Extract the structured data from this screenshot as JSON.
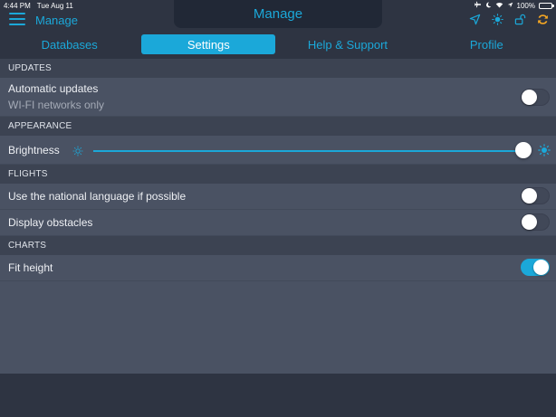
{
  "status_bar": {
    "time": "4:44 PM",
    "date": "Tue Aug 11",
    "battery": "100%",
    "battery_level": 1.0
  },
  "header": {
    "menu_label": "Manage",
    "title": "Manage",
    "icons": [
      "location-arrow-icon",
      "sun-icon",
      "unlock-icon",
      "sync-icon"
    ]
  },
  "tabs": [
    {
      "label": "Databases",
      "active": false
    },
    {
      "label": "Settings",
      "active": true
    },
    {
      "label": "Help & Support",
      "active": false
    },
    {
      "label": "Profile",
      "active": false
    }
  ],
  "sections": {
    "updates": {
      "title": "UPDATES",
      "automatic_updates": {
        "label": "Automatic updates",
        "sublabel": "WI-FI networks only",
        "on": false
      }
    },
    "appearance": {
      "title": "APPEARANCE",
      "brightness": {
        "label": "Brightness",
        "value": 1.0
      }
    },
    "flights": {
      "title": "FLIGHTS",
      "national_language": {
        "label": "Use the national language if possible",
        "on": false
      },
      "display_obstacles": {
        "label": "Display obstacles",
        "on": false
      }
    },
    "charts": {
      "title": "CHARTS",
      "fit_height": {
        "label": "Fit height",
        "on": true
      }
    }
  },
  "colors": {
    "accent": "#1ba8d9",
    "background": "#2e3442",
    "panel": "#4a5263",
    "section_header": "#3c4352"
  }
}
